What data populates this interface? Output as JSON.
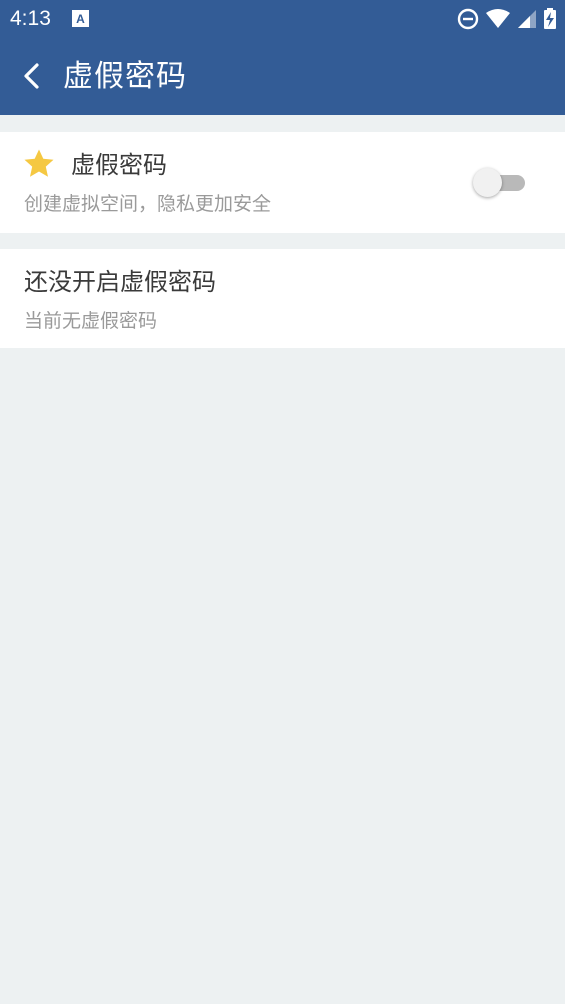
{
  "colors": {
    "brand": "#335c96",
    "star": "#f5c842",
    "background": "#edf1f2"
  },
  "status_bar": {
    "time": "4:13",
    "icons": [
      "text-a-icon",
      "do-not-disturb-icon",
      "wifi-icon",
      "signal-icon",
      "battery-charging-icon"
    ]
  },
  "app_bar": {
    "back_icon": "chevron-left-icon",
    "title": "虚假密码"
  },
  "fake_password_setting": {
    "icon": "star-icon",
    "title": "虚假密码",
    "subtitle": "创建虚拟空间，隐私更加安全",
    "enabled": false
  },
  "fake_password_status": {
    "title": "还没开启虚假密码",
    "subtitle": "当前无虚假密码"
  }
}
